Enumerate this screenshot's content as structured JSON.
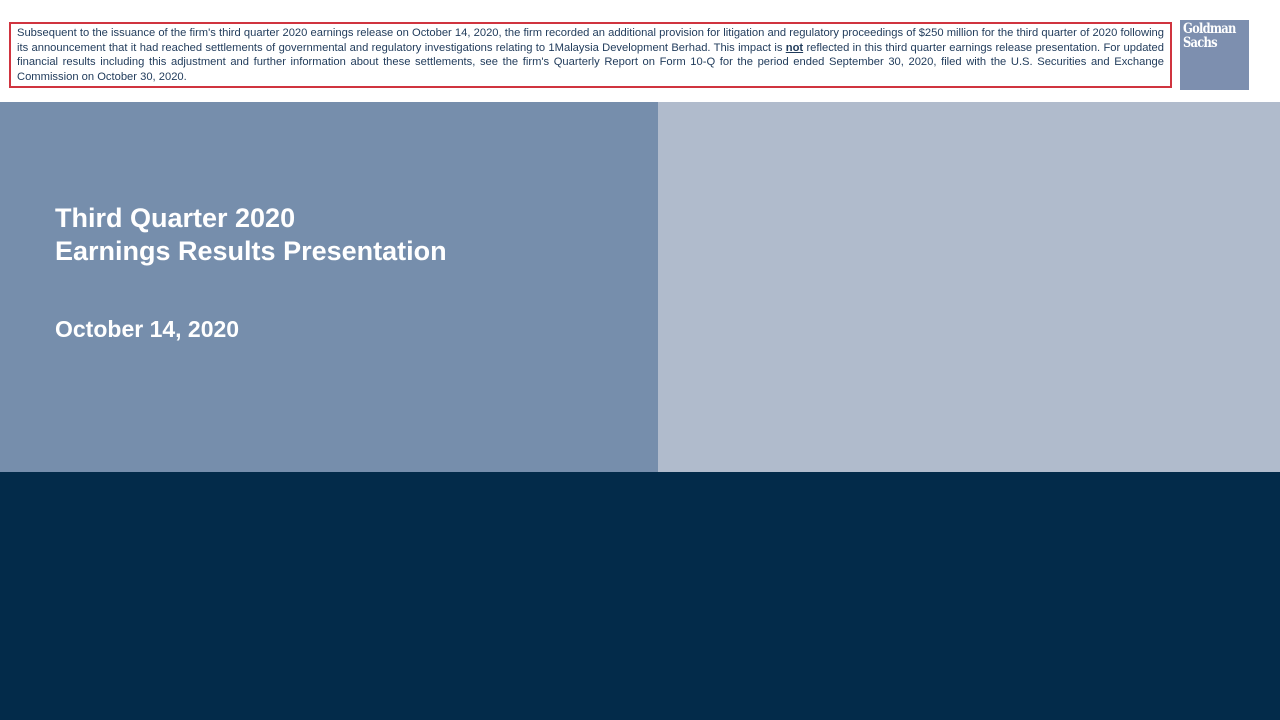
{
  "disclaimer": {
    "text_before": "Subsequent to the issuance of the firm's third quarter 2020 earnings release on October 14, 2020, the firm recorded an additional provision for litigation and regulatory proceedings of $250 million for the third quarter of 2020 following its announcement that it had reached settlements of governmental and regulatory investigations relating to 1Malaysia Development Berhad. This impact is ",
    "emphasis": "not",
    "text_after": " reflected in this third quarter earnings release presentation. For updated financial results including this adjustment and further information about these settlements, see the firm's Quarterly Report on Form 10-Q for the period ended September 30, 2020, filed with the U.S. Securities and Exchange Commission on October 30, 2020.",
    "border_color": "#d0343f",
    "text_color": "#1f3a5a"
  },
  "logo": {
    "line1": "Goldman",
    "line2": "Sachs",
    "background": "#7d8faf"
  },
  "hero": {
    "title_line1": "Third Quarter 2020",
    "title_line2": "Earnings Results Presentation",
    "date": "October 14, 2020",
    "left_color": "#768eac",
    "right_color": "#b0bbcc"
  },
  "footer": {
    "color": "#032b4a"
  }
}
